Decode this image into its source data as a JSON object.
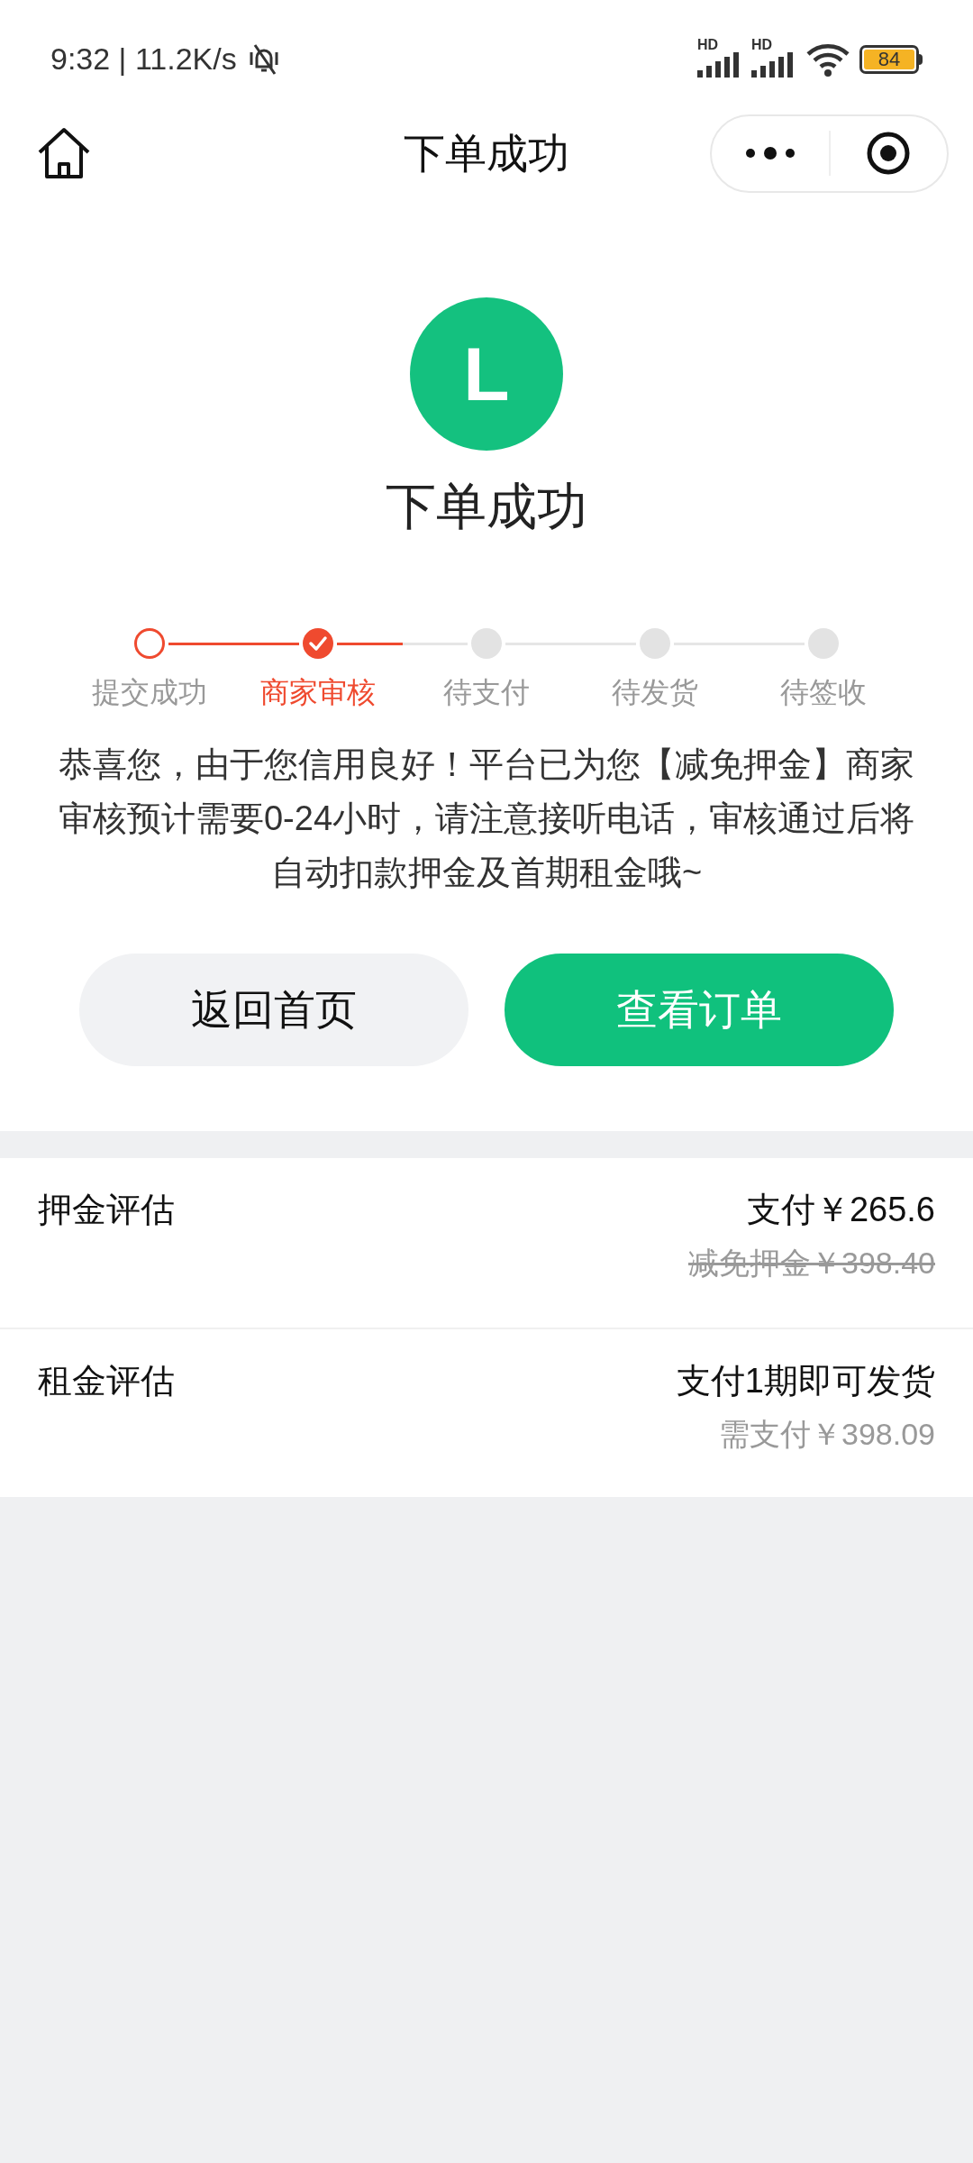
{
  "status_bar": {
    "time_speed": "9:32 | 11.2K/s",
    "network_labels": [
      "HD",
      "HD"
    ],
    "battery": "84"
  },
  "nav_bar": {
    "title": "下单成功"
  },
  "result": {
    "logo_letter": "L",
    "title": "下单成功"
  },
  "steps": [
    {
      "label": "提交成功",
      "kind": "done"
    },
    {
      "label": "商家审核",
      "kind": "current"
    },
    {
      "label": "待支付",
      "kind": "pending"
    },
    {
      "label": "待发货",
      "kind": "pending"
    },
    {
      "label": "待签收",
      "kind": "pending"
    }
  ],
  "message": "恭喜您，由于您信用良好！平台已为您【减免押金】商家审核预计需要0-24小时，请注意接听电话，审核通过后将自动扣款押金及首期租金哦~",
  "buttons": [
    {
      "label": "返回首页",
      "kind": "secondary"
    },
    {
      "label": "查看订单",
      "kind": "primary"
    }
  ],
  "summary": [
    {
      "label": "押金评估",
      "value": "支付￥265.6",
      "note": "减免押金￥398.40",
      "struck": true
    },
    {
      "label": "租金评估",
      "value": "支付1期即可发货",
      "note": "需支付￥398.09",
      "struck": false
    }
  ]
}
